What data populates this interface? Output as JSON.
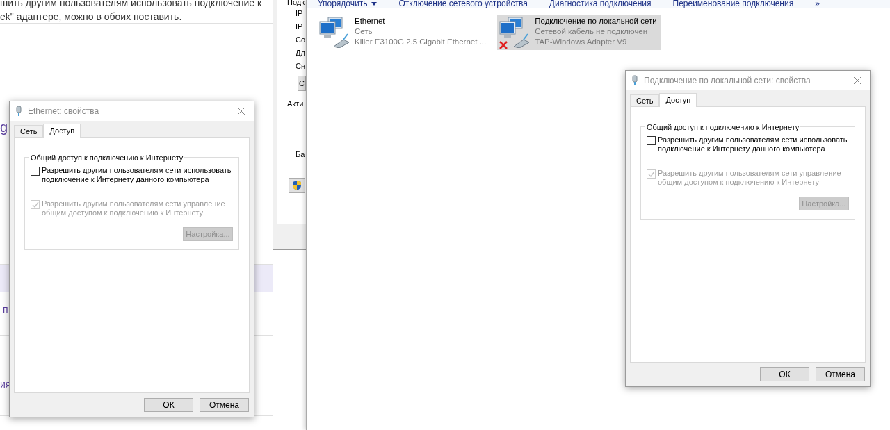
{
  "background_page": {
    "lines": [
      "шить другим пользователям использовать подключение к",
      "ek\" адаптере, можно в обоих поставить."
    ],
    "fragments": [
      "g",
      "п",
      "ия"
    ]
  },
  "status_window": {
    "labels": [
      "Подк",
      "IP",
      "IP",
      "Co",
      "Дл",
      "Сн"
    ],
    "button": "С",
    "section_labels": [
      "Акти",
      "Ба"
    ]
  },
  "explorer": {
    "toolbar": [
      {
        "label": "Упорядочить",
        "menu": true
      },
      {
        "label": "Отключение сетевого устройства",
        "menu": false
      },
      {
        "label": "Диагностика подключения",
        "menu": false
      },
      {
        "label": "Переименование подключения",
        "menu": false
      },
      {
        "label": "»",
        "menu": false
      }
    ],
    "connections": [
      {
        "name": "Ethernet",
        "status": "Сеть",
        "adapter": "Killer E3100G 2.5 Gigabit Ethernet ...",
        "selected": false,
        "disconnected": false
      },
      {
        "name": "Подключение по локальной сети",
        "status": "Сетевой кабель не подключен",
        "adapter": "TAP-Windows Adapter V9",
        "selected": true,
        "disconnected": true
      }
    ]
  },
  "dialogs": [
    {
      "title": "Ethernet: свойства",
      "tabs": [
        {
          "label": "Сеть",
          "selected": false
        },
        {
          "label": "Доступ",
          "selected": true
        }
      ],
      "group": {
        "title": "Общий доступ к подключению к Интернету",
        "options": [
          {
            "label": "Разрешить другим пользователям сети использовать подключение к Интернету данного компьютера",
            "checked": false,
            "disabled": false
          },
          {
            "label": "Разрешить другим пользователям сети управление общим доступом к подключению к Интернету",
            "checked": true,
            "disabled": true
          }
        ],
        "button": {
          "label": "Настройка...",
          "disabled": true
        }
      },
      "buttons": [
        "ОК",
        "Отмена"
      ]
    },
    {
      "title": "Подключение по локальной сети: свойства",
      "tabs": [
        {
          "label": "Сеть",
          "selected": false
        },
        {
          "label": "Доступ",
          "selected": true
        }
      ],
      "group": {
        "title": "Общий доступ к подключению к Интернету",
        "options": [
          {
            "label": "Разрешить другим пользователям сети использовать подключение к Интернету данного компьютера",
            "checked": false,
            "disabled": false
          },
          {
            "label": "Разрешить другим пользователям сети управление общим доступом к подключению к Интернету",
            "checked": true,
            "disabled": true
          }
        ],
        "button": {
          "label": "Настройка...",
          "disabled": true
        }
      },
      "buttons": [
        "ОК",
        "Отмена"
      ]
    }
  ]
}
